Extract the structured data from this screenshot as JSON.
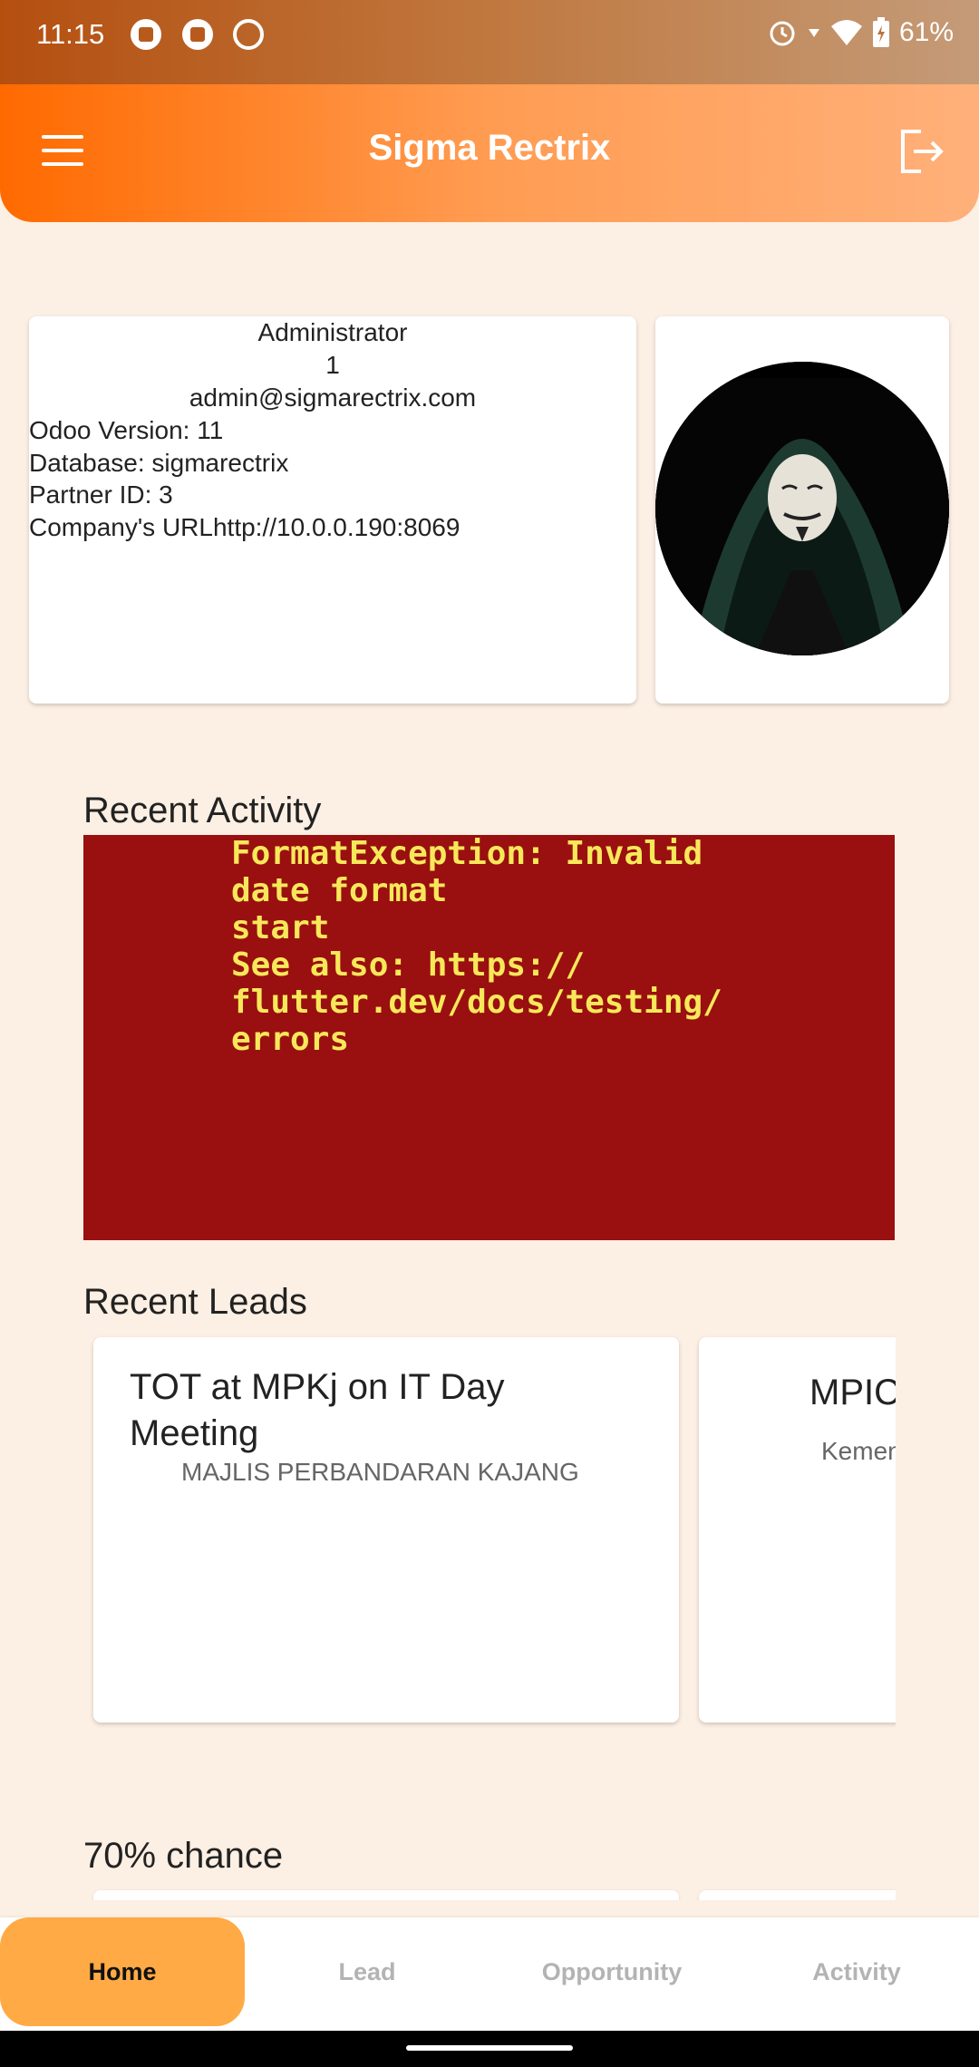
{
  "status_bar": {
    "time": "11:15",
    "battery": "61%"
  },
  "app_bar": {
    "title": "Sigma Rectrix"
  },
  "profile": {
    "name": "Administrator",
    "uid": "1",
    "email": "admin@sigmarectrix.com",
    "odoo_version": "Odoo Version: 11",
    "database": "Database: sigmarectrix",
    "partner_id": "Partner ID: 3",
    "company_url": "Company's URLhttp://10.0.0.190:8069"
  },
  "recent_activity": {
    "title": "Recent Activity",
    "error_lines": [
      "FormatException: Invalid",
      "date format",
      "start",
      "See also: https://",
      "flutter.dev/docs/testing/",
      "errors"
    ]
  },
  "recent_leads": {
    "title": "Recent Leads",
    "items": [
      {
        "title": "TOT at MPKj on IT Day Meeting",
        "company": "MAJLIS PERBANDARAN KAJANG"
      },
      {
        "title": "MPIC",
        "company": "Kemen"
      }
    ]
  },
  "chance": {
    "title": "70% chance"
  },
  "bottom_nav": {
    "items": [
      {
        "label": "Home",
        "active": true
      },
      {
        "label": "Lead",
        "active": false
      },
      {
        "label": "Opportunity",
        "active": false
      },
      {
        "label": "Activity",
        "active": false
      }
    ]
  },
  "colors": {
    "app_bar_start": "#ff6a00",
    "app_bar_end": "#ffb07a",
    "background": "#fcefe3",
    "error_background": "#9a0f0f",
    "error_text": "#f7e85a",
    "nav_active": "#ffaa45"
  }
}
